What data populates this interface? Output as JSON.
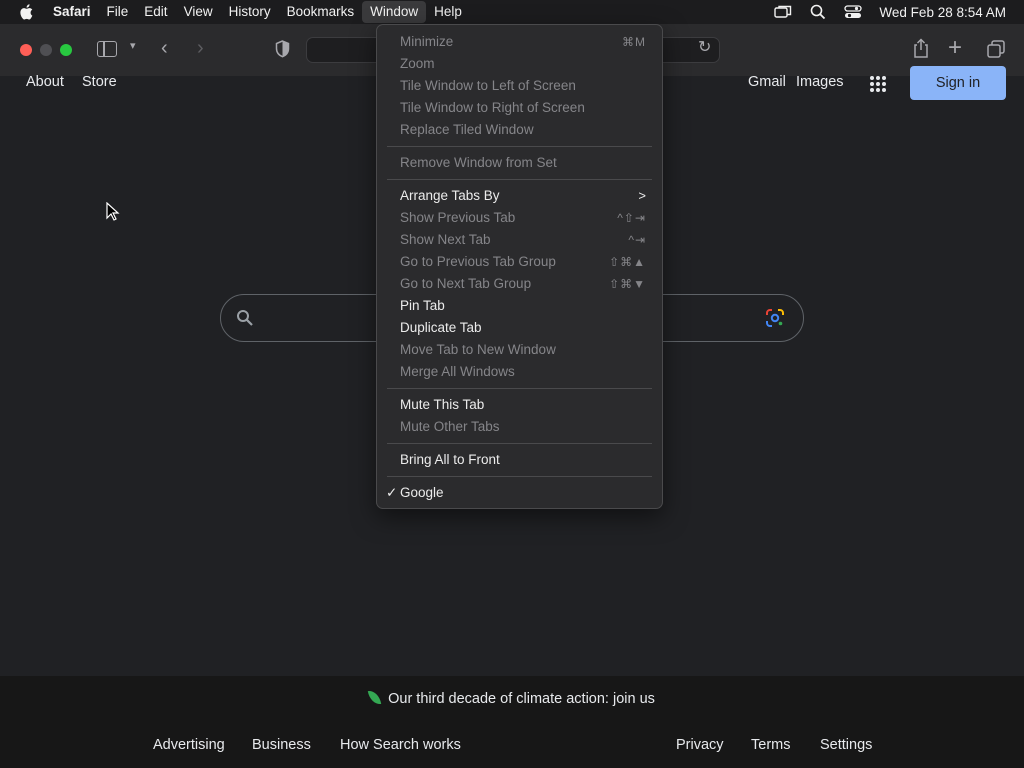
{
  "menubar": {
    "app_name": "Safari",
    "items": [
      "File",
      "Edit",
      "View",
      "History",
      "Bookmarks",
      "Window",
      "Help"
    ],
    "active_item": "Window",
    "clock": "Wed Feb 28  8:54 AM"
  },
  "window_menu": {
    "items": [
      {
        "label": "Minimize",
        "shortcut": "⌘M",
        "enabled": false
      },
      {
        "label": "Zoom",
        "shortcut": "",
        "enabled": false
      },
      {
        "label": "Tile Window to Left of Screen",
        "shortcut": "",
        "enabled": false
      },
      {
        "label": "Tile Window to Right of Screen",
        "shortcut": "",
        "enabled": false
      },
      {
        "label": "Replace Tiled Window",
        "shortcut": "",
        "enabled": false
      },
      {
        "label": "Remove Window from Set",
        "shortcut": "",
        "enabled": false
      },
      {
        "label": "Arrange Tabs By",
        "shortcut": ">",
        "enabled": true,
        "submenu": true
      },
      {
        "label": "Show Previous Tab",
        "shortcut": "^⇧⇥",
        "enabled": false
      },
      {
        "label": "Show Next Tab",
        "shortcut": "^⇥",
        "enabled": false
      },
      {
        "label": "Go to Previous Tab Group",
        "shortcut": "⇧⌘▲",
        "enabled": false
      },
      {
        "label": "Go to Next Tab Group",
        "shortcut": "⇧⌘▼",
        "enabled": false
      },
      {
        "label": "Pin Tab",
        "shortcut": "",
        "enabled": true
      },
      {
        "label": "Duplicate Tab",
        "shortcut": "",
        "enabled": true
      },
      {
        "label": "Move Tab to New Window",
        "shortcut": "",
        "enabled": false
      },
      {
        "label": "Merge All Windows",
        "shortcut": "",
        "enabled": false
      },
      {
        "label": "Mute This Tab",
        "shortcut": "",
        "enabled": true
      },
      {
        "label": "Mute Other Tabs",
        "shortcut": "",
        "enabled": false
      },
      {
        "label": "Bring All to Front",
        "shortcut": "",
        "enabled": true
      },
      {
        "label": "Google",
        "shortcut": "",
        "enabled": true,
        "checked": true,
        "check_mark": "✓"
      }
    ]
  },
  "page": {
    "top_left_links": [
      "About",
      "Store"
    ],
    "top_right_links": [
      "Gmail",
      "Images"
    ],
    "sign_in_label": "Sign in",
    "climate_text": "Our third decade of climate action: join us",
    "footer_left": [
      "Advertising",
      "Business",
      "How Search works"
    ],
    "footer_right": [
      "Privacy",
      "Terms",
      "Settings"
    ]
  },
  "colors": {
    "page_bg": "#202124",
    "sign_in_bg": "#8ab4f8",
    "footer_bg": "#171717",
    "menu_bg": "#2b2b2d"
  }
}
